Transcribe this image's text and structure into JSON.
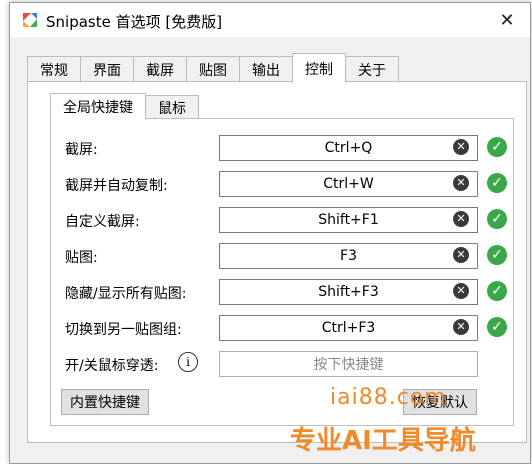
{
  "window": {
    "title": "Snipaste 首选项 [免费版]",
    "close_glyph": "✕"
  },
  "tabs": [
    {
      "label": "常规"
    },
    {
      "label": "界面"
    },
    {
      "label": "截屏"
    },
    {
      "label": "贴图"
    },
    {
      "label": "输出"
    },
    {
      "label": "控制"
    },
    {
      "label": "关于"
    }
  ],
  "active_tab": "控制",
  "subtabs": [
    {
      "label": "全局快捷键"
    },
    {
      "label": "鼠标"
    }
  ],
  "active_subtab": "全局快捷键",
  "shortcuts": [
    {
      "label": "截屏:",
      "value": "Ctrl+Q"
    },
    {
      "label": "截屏并自动复制:",
      "value": "Ctrl+W"
    },
    {
      "label": "自定义截屏:",
      "value": "Shift+F1"
    },
    {
      "label": "贴图:",
      "value": "F3"
    },
    {
      "label": "隐藏/显示所有贴图:",
      "value": "Shift+F3"
    },
    {
      "label": "切换到另一贴图组:",
      "value": "Ctrl+F3"
    }
  ],
  "mouse_passthrough": {
    "label": "开/关鼠标穿透:",
    "placeholder": "按下快捷键",
    "info_glyph": "i"
  },
  "buttons": {
    "builtin": "内置快捷键",
    "restore": "恢复默认"
  },
  "icons": {
    "clear": "clear-icon",
    "check": "check-icon",
    "app": "snipaste-icon"
  },
  "colors": {
    "check": "#3aa84a",
    "watermark": "#f08a2a"
  },
  "watermark": {
    "line1": "iai88.com",
    "line2": "专业AI工具导航"
  }
}
